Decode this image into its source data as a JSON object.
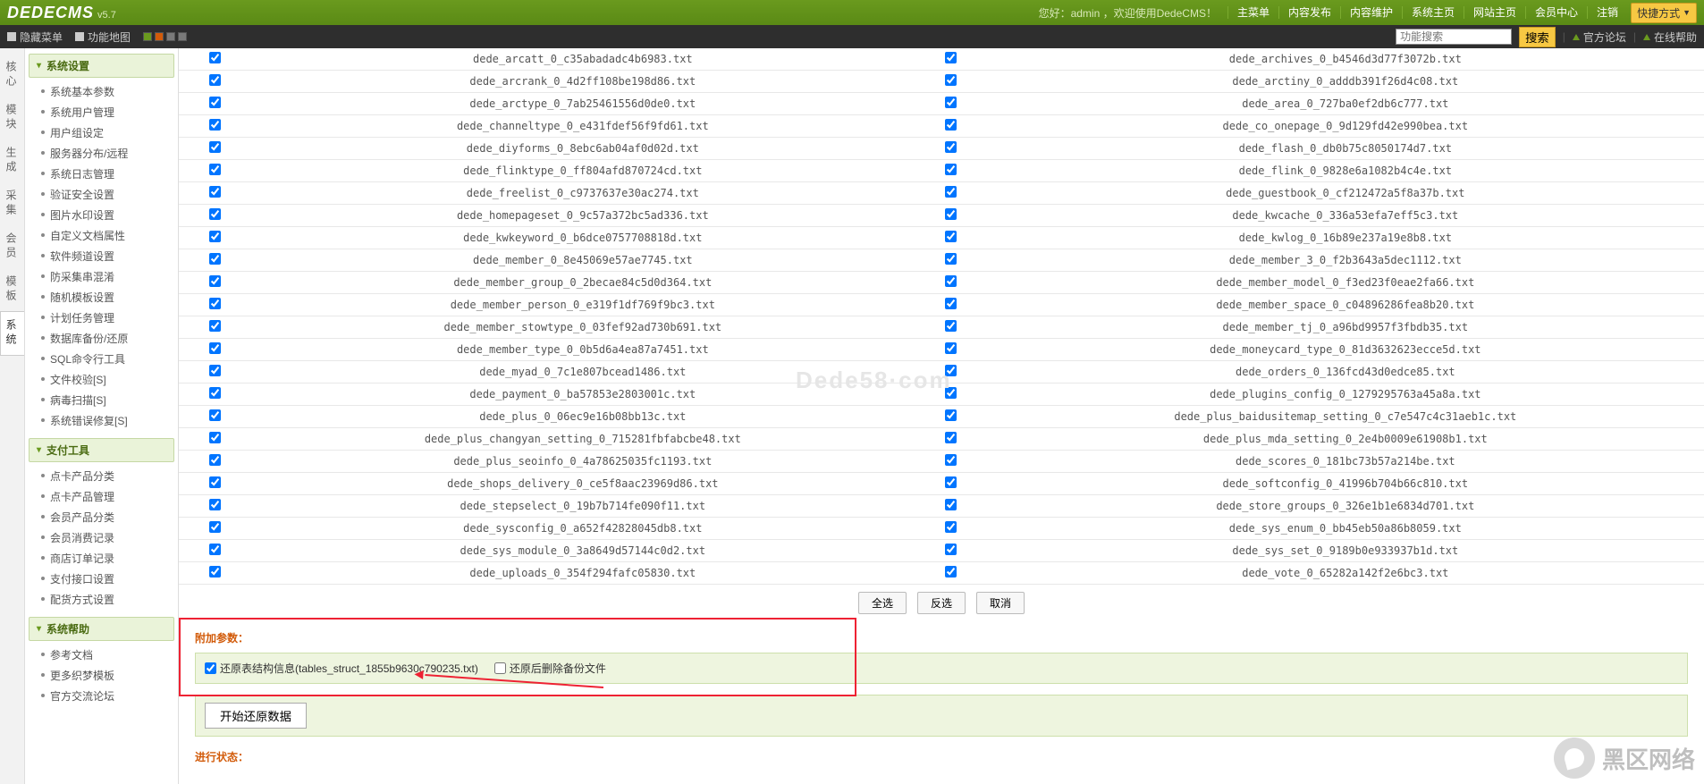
{
  "header": {
    "logo": "DEDECMS",
    "version": "v5.7",
    "welcome": "您好：admin ，欢迎使用DedeCMS！",
    "nav": [
      "主菜单",
      "内容发布",
      "内容维护",
      "系统主页",
      "网站主页",
      "会员中心",
      "注销"
    ],
    "quick": "快捷方式"
  },
  "subbar": {
    "hide_menu": "隐藏菜单",
    "site_map": "功能地图",
    "colors": [
      "#6a9a1e",
      "#d25b0a",
      "#7a7a7a",
      "#7a7a7a"
    ],
    "search_placeholder": "功能搜索",
    "search_btn": "搜索",
    "forum": "官方论坛",
    "help": "在线帮助"
  },
  "vtabs": [
    "核心",
    "模块",
    "生成",
    "采集",
    "会员",
    "模板",
    "系统"
  ],
  "vtab_active": 6,
  "sidebar": [
    {
      "title": "系统设置",
      "items": [
        "系统基本参数",
        "系统用户管理",
        "用户组设定",
        "服务器分布/远程",
        "系统日志管理",
        "验证安全设置",
        "图片水印设置",
        "自定义文档属性",
        "软件频道设置",
        "防采集串混淆",
        "随机模板设置",
        "计划任务管理",
        "数据库备份/还原",
        "SQL命令行工具",
        "文件校验[S]",
        "病毒扫描[S]",
        "系统错误修复[S]"
      ]
    },
    {
      "title": "支付工具",
      "items": [
        "点卡产品分类",
        "点卡产品管理",
        "会员产品分类",
        "会员消费记录",
        "商店订单记录",
        "支付接口设置",
        "配货方式设置"
      ]
    },
    {
      "title": "系统帮助",
      "items": [
        "参考文档",
        "更多织梦模板",
        "官方交流论坛"
      ]
    }
  ],
  "file_rows": [
    [
      "dede_arcatt_0_c35abadadc4b6983.txt",
      "dede_archives_0_b4546d3d77f3072b.txt"
    ],
    [
      "dede_arcrank_0_4d2ff108be198d86.txt",
      "dede_arctiny_0_adddb391f26d4c08.txt"
    ],
    [
      "dede_arctype_0_7ab25461556d0de0.txt",
      "dede_area_0_727ba0ef2db6c777.txt"
    ],
    [
      "dede_channeltype_0_e431fdef56f9fd61.txt",
      "dede_co_onepage_0_9d129fd42e990bea.txt"
    ],
    [
      "dede_diyforms_0_8ebc6ab04af0d02d.txt",
      "dede_flash_0_db0b75c8050174d7.txt"
    ],
    [
      "dede_flinktype_0_ff804afd870724cd.txt",
      "dede_flink_0_9828e6a1082b4c4e.txt"
    ],
    [
      "dede_freelist_0_c9737637e30ac274.txt",
      "dede_guestbook_0_cf212472a5f8a37b.txt"
    ],
    [
      "dede_homepageset_0_9c57a372bc5ad336.txt",
      "dede_kwcache_0_336a53efa7eff5c3.txt"
    ],
    [
      "dede_kwkeyword_0_b6dce0757708818d.txt",
      "dede_kwlog_0_16b89e237a19e8b8.txt"
    ],
    [
      "dede_member_0_8e45069e57ae7745.txt",
      "dede_member_3_0_f2b3643a5dec1112.txt"
    ],
    [
      "dede_member_group_0_2becae84c5d0d364.txt",
      "dede_member_model_0_f3ed23f0eae2fa66.txt"
    ],
    [
      "dede_member_person_0_e319f1df769f9bc3.txt",
      "dede_member_space_0_c04896286fea8b20.txt"
    ],
    [
      "dede_member_stowtype_0_03fef92ad730b691.txt",
      "dede_member_tj_0_a96bd9957f3fbdb35.txt"
    ],
    [
      "dede_member_type_0_0b5d6a4ea87a7451.txt",
      "dede_moneycard_type_0_81d3632623ecce5d.txt"
    ],
    [
      "dede_myad_0_7c1e807bcead1486.txt",
      "dede_orders_0_136fcd43d0edce85.txt"
    ],
    [
      "dede_payment_0_ba57853e2803001c.txt",
      "dede_plugins_config_0_1279295763a45a8a.txt"
    ],
    [
      "dede_plus_0_06ec9e16b08bb13c.txt",
      "dede_plus_baidusitemap_setting_0_c7e547c4c31aeb1c.txt"
    ],
    [
      "dede_plus_changyan_setting_0_715281fbfabcbe48.txt",
      "dede_plus_mda_setting_0_2e4b0009e61908b1.txt"
    ],
    [
      "dede_plus_seoinfo_0_4a78625035fc1193.txt",
      "dede_scores_0_181bc73b57a214be.txt"
    ],
    [
      "dede_shops_delivery_0_ce5f8aac23969d86.txt",
      "dede_softconfig_0_41996b704b66c810.txt"
    ],
    [
      "dede_stepselect_0_19b7b714fe090f11.txt",
      "dede_store_groups_0_326e1b1e6834d701.txt"
    ],
    [
      "dede_sysconfig_0_a652f42828045db8.txt",
      "dede_sys_enum_0_bb45eb50a86b8059.txt"
    ],
    [
      "dede_sys_module_0_3a8649d57144c0d2.txt",
      "dede_sys_set_0_9189b0e933937b1d.txt"
    ],
    [
      "dede_uploads_0_354f294fafc05830.txt",
      "dede_vote_0_65282a142f2e6bc3.txt"
    ]
  ],
  "sel_buttons": [
    "全选",
    "反选",
    "取消"
  ],
  "opts": {
    "title": "附加参数：",
    "restore_struct_label": "还原表结构信息(tables_struct_1855b9630c790235.txt)",
    "delete_after_label": "还原后删除备份文件",
    "start_btn": "开始还原数据",
    "status_title": "进行状态："
  },
  "watermark": "Dede58·com",
  "bottom_logo_text": "黑区网络"
}
